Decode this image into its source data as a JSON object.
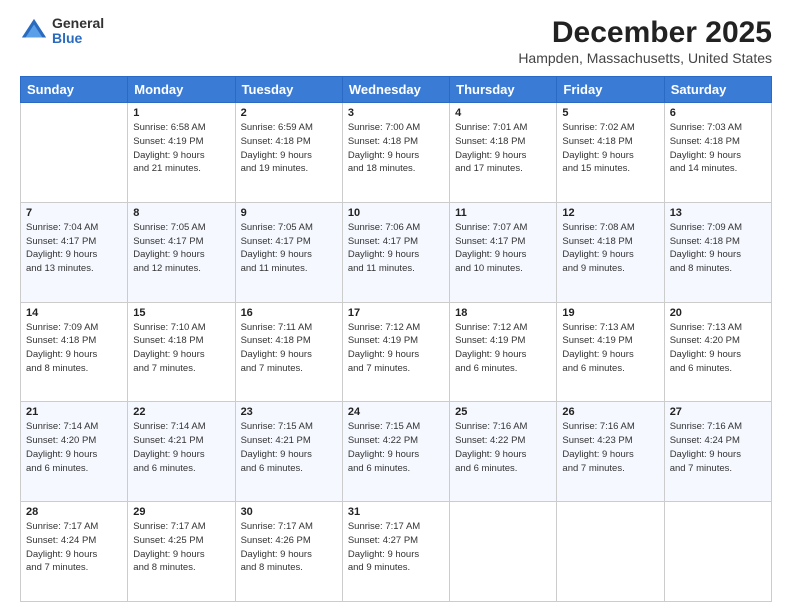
{
  "logo": {
    "general": "General",
    "blue": "Blue"
  },
  "header": {
    "title": "December 2025",
    "subtitle": "Hampden, Massachusetts, United States"
  },
  "days_of_week": [
    "Sunday",
    "Monday",
    "Tuesday",
    "Wednesday",
    "Thursday",
    "Friday",
    "Saturday"
  ],
  "weeks": [
    [
      {
        "num": "",
        "detail": ""
      },
      {
        "num": "1",
        "detail": "Sunrise: 6:58 AM\nSunset: 4:19 PM\nDaylight: 9 hours\nand 21 minutes."
      },
      {
        "num": "2",
        "detail": "Sunrise: 6:59 AM\nSunset: 4:18 PM\nDaylight: 9 hours\nand 19 minutes."
      },
      {
        "num": "3",
        "detail": "Sunrise: 7:00 AM\nSunset: 4:18 PM\nDaylight: 9 hours\nand 18 minutes."
      },
      {
        "num": "4",
        "detail": "Sunrise: 7:01 AM\nSunset: 4:18 PM\nDaylight: 9 hours\nand 17 minutes."
      },
      {
        "num": "5",
        "detail": "Sunrise: 7:02 AM\nSunset: 4:18 PM\nDaylight: 9 hours\nand 15 minutes."
      },
      {
        "num": "6",
        "detail": "Sunrise: 7:03 AM\nSunset: 4:18 PM\nDaylight: 9 hours\nand 14 minutes."
      }
    ],
    [
      {
        "num": "7",
        "detail": "Sunrise: 7:04 AM\nSunset: 4:17 PM\nDaylight: 9 hours\nand 13 minutes."
      },
      {
        "num": "8",
        "detail": "Sunrise: 7:05 AM\nSunset: 4:17 PM\nDaylight: 9 hours\nand 12 minutes."
      },
      {
        "num": "9",
        "detail": "Sunrise: 7:05 AM\nSunset: 4:17 PM\nDaylight: 9 hours\nand 11 minutes."
      },
      {
        "num": "10",
        "detail": "Sunrise: 7:06 AM\nSunset: 4:17 PM\nDaylight: 9 hours\nand 11 minutes."
      },
      {
        "num": "11",
        "detail": "Sunrise: 7:07 AM\nSunset: 4:17 PM\nDaylight: 9 hours\nand 10 minutes."
      },
      {
        "num": "12",
        "detail": "Sunrise: 7:08 AM\nSunset: 4:18 PM\nDaylight: 9 hours\nand 9 minutes."
      },
      {
        "num": "13",
        "detail": "Sunrise: 7:09 AM\nSunset: 4:18 PM\nDaylight: 9 hours\nand 8 minutes."
      }
    ],
    [
      {
        "num": "14",
        "detail": "Sunrise: 7:09 AM\nSunset: 4:18 PM\nDaylight: 9 hours\nand 8 minutes."
      },
      {
        "num": "15",
        "detail": "Sunrise: 7:10 AM\nSunset: 4:18 PM\nDaylight: 9 hours\nand 7 minutes."
      },
      {
        "num": "16",
        "detail": "Sunrise: 7:11 AM\nSunset: 4:18 PM\nDaylight: 9 hours\nand 7 minutes."
      },
      {
        "num": "17",
        "detail": "Sunrise: 7:12 AM\nSunset: 4:19 PM\nDaylight: 9 hours\nand 7 minutes."
      },
      {
        "num": "18",
        "detail": "Sunrise: 7:12 AM\nSunset: 4:19 PM\nDaylight: 9 hours\nand 6 minutes."
      },
      {
        "num": "19",
        "detail": "Sunrise: 7:13 AM\nSunset: 4:19 PM\nDaylight: 9 hours\nand 6 minutes."
      },
      {
        "num": "20",
        "detail": "Sunrise: 7:13 AM\nSunset: 4:20 PM\nDaylight: 9 hours\nand 6 minutes."
      }
    ],
    [
      {
        "num": "21",
        "detail": "Sunrise: 7:14 AM\nSunset: 4:20 PM\nDaylight: 9 hours\nand 6 minutes."
      },
      {
        "num": "22",
        "detail": "Sunrise: 7:14 AM\nSunset: 4:21 PM\nDaylight: 9 hours\nand 6 minutes."
      },
      {
        "num": "23",
        "detail": "Sunrise: 7:15 AM\nSunset: 4:21 PM\nDaylight: 9 hours\nand 6 minutes."
      },
      {
        "num": "24",
        "detail": "Sunrise: 7:15 AM\nSunset: 4:22 PM\nDaylight: 9 hours\nand 6 minutes."
      },
      {
        "num": "25",
        "detail": "Sunrise: 7:16 AM\nSunset: 4:22 PM\nDaylight: 9 hours\nand 6 minutes."
      },
      {
        "num": "26",
        "detail": "Sunrise: 7:16 AM\nSunset: 4:23 PM\nDaylight: 9 hours\nand 7 minutes."
      },
      {
        "num": "27",
        "detail": "Sunrise: 7:16 AM\nSunset: 4:24 PM\nDaylight: 9 hours\nand 7 minutes."
      }
    ],
    [
      {
        "num": "28",
        "detail": "Sunrise: 7:17 AM\nSunset: 4:24 PM\nDaylight: 9 hours\nand 7 minutes."
      },
      {
        "num": "29",
        "detail": "Sunrise: 7:17 AM\nSunset: 4:25 PM\nDaylight: 9 hours\nand 8 minutes."
      },
      {
        "num": "30",
        "detail": "Sunrise: 7:17 AM\nSunset: 4:26 PM\nDaylight: 9 hours\nand 8 minutes."
      },
      {
        "num": "31",
        "detail": "Sunrise: 7:17 AM\nSunset: 4:27 PM\nDaylight: 9 hours\nand 9 minutes."
      },
      {
        "num": "",
        "detail": ""
      },
      {
        "num": "",
        "detail": ""
      },
      {
        "num": "",
        "detail": ""
      }
    ]
  ]
}
